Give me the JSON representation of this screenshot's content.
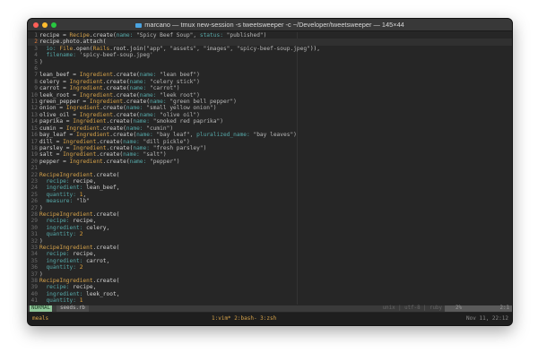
{
  "window": {
    "title": "marcano — tmux new-session -s tweetsweeper -c ~/Developer/tweetsweeper — 145×44",
    "traffic_lights": {
      "close": "#fe5f57",
      "minimize": "#febc2e",
      "maximize": "#28c840"
    }
  },
  "editor": {
    "cursor_line": 2,
    "lines": [
      [
        [
          "recipe = ",
          "t"
        ],
        [
          "Recipe",
          "c"
        ],
        [
          ".create(",
          "t"
        ],
        [
          "name:",
          "k"
        ],
        [
          " \"Spicy Beef Soup\", ",
          "s"
        ],
        [
          "status:",
          "k"
        ],
        [
          " \"published\")",
          "s"
        ]
      ],
      [
        [
          "recipe.photo.attach(",
          "t"
        ]
      ],
      [
        [
          "  ",
          "t"
        ],
        [
          "io:",
          "k"
        ],
        [
          " ",
          "t"
        ],
        [
          "File",
          "c"
        ],
        [
          ".open(",
          "t"
        ],
        [
          "Rails",
          "c"
        ],
        [
          ".root.join(",
          "t"
        ],
        [
          "\"app\", \"assets\", \"images\", \"spicy-beef-soup.jpeg\"",
          "s"
        ],
        [
          ")),",
          "t"
        ]
      ],
      [
        [
          "  ",
          "t"
        ],
        [
          "filename:",
          "k"
        ],
        [
          " 'spicy-beef-soup.jpeg'",
          "s"
        ]
      ],
      [
        [
          ")",
          "t"
        ]
      ],
      [],
      [
        [
          "lean_beef = ",
          "t"
        ],
        [
          "Ingredient",
          "c"
        ],
        [
          ".create(",
          "t"
        ],
        [
          "name:",
          "k"
        ],
        [
          " \"lean beef\")",
          "s"
        ]
      ],
      [
        [
          "celery = ",
          "t"
        ],
        [
          "Ingredient",
          "c"
        ],
        [
          ".create(",
          "t"
        ],
        [
          "name:",
          "k"
        ],
        [
          " \"celery stick\")",
          "s"
        ]
      ],
      [
        [
          "carrot = ",
          "t"
        ],
        [
          "Ingredient",
          "c"
        ],
        [
          ".create(",
          "t"
        ],
        [
          "name:",
          "k"
        ],
        [
          " \"carrot\")",
          "s"
        ]
      ],
      [
        [
          "leek_root = ",
          "t"
        ],
        [
          "Ingredient",
          "c"
        ],
        [
          ".create(",
          "t"
        ],
        [
          "name:",
          "k"
        ],
        [
          " \"leek root\")",
          "s"
        ]
      ],
      [
        [
          "green_pepper = ",
          "t"
        ],
        [
          "Ingredient",
          "c"
        ],
        [
          ".create(",
          "t"
        ],
        [
          "name:",
          "k"
        ],
        [
          " \"green bell pepper\")",
          "s"
        ]
      ],
      [
        [
          "onion = ",
          "t"
        ],
        [
          "Ingredient",
          "c"
        ],
        [
          ".create(",
          "t"
        ],
        [
          "name:",
          "k"
        ],
        [
          " \"small yellow onion\")",
          "s"
        ]
      ],
      [
        [
          "olive_oil = ",
          "t"
        ],
        [
          "Ingredient",
          "c"
        ],
        [
          ".create(",
          "t"
        ],
        [
          "name:",
          "k"
        ],
        [
          " \"olive oil\")",
          "s"
        ]
      ],
      [
        [
          "paprika = ",
          "t"
        ],
        [
          "Ingredient",
          "c"
        ],
        [
          ".create(",
          "t"
        ],
        [
          "name:",
          "k"
        ],
        [
          " \"smoked red paprika\")",
          "s"
        ]
      ],
      [
        [
          "cumin = ",
          "t"
        ],
        [
          "Ingredient",
          "c"
        ],
        [
          ".create(",
          "t"
        ],
        [
          "name:",
          "k"
        ],
        [
          " \"cumin\")",
          "s"
        ]
      ],
      [
        [
          "bay_leaf = ",
          "t"
        ],
        [
          "Ingredient",
          "c"
        ],
        [
          ".create(",
          "t"
        ],
        [
          "name:",
          "k"
        ],
        [
          " \"bay leaf\", ",
          "s"
        ],
        [
          "pluralized_name:",
          "k"
        ],
        [
          " \"bay leaves\")",
          "s"
        ]
      ],
      [
        [
          "dill = ",
          "t"
        ],
        [
          "Ingredient",
          "c"
        ],
        [
          ".create(",
          "t"
        ],
        [
          "name:",
          "k"
        ],
        [
          " \"dill pickle\")",
          "s"
        ]
      ],
      [
        [
          "parsley = ",
          "t"
        ],
        [
          "Ingredient",
          "c"
        ],
        [
          ".create(",
          "t"
        ],
        [
          "name:",
          "k"
        ],
        [
          " \"fresh parsley\")",
          "s"
        ]
      ],
      [
        [
          "salt = ",
          "t"
        ],
        [
          "Ingredient",
          "c"
        ],
        [
          ".create(",
          "t"
        ],
        [
          "name:",
          "k"
        ],
        [
          " \"salt\")",
          "s"
        ]
      ],
      [
        [
          "pepper = ",
          "t"
        ],
        [
          "Ingredient",
          "c"
        ],
        [
          ".create(",
          "t"
        ],
        [
          "name:",
          "k"
        ],
        [
          " \"pepper\")",
          "s"
        ]
      ],
      [],
      [
        [
          "RecipeIngredient",
          "c"
        ],
        [
          ".create(",
          "t"
        ]
      ],
      [
        [
          "  ",
          "t"
        ],
        [
          "recipe:",
          "k"
        ],
        [
          " recipe,",
          "t"
        ]
      ],
      [
        [
          "  ",
          "t"
        ],
        [
          "ingredient:",
          "k"
        ],
        [
          " lean_beef,",
          "t"
        ]
      ],
      [
        [
          "  ",
          "t"
        ],
        [
          "quantity:",
          "k"
        ],
        [
          " ",
          "t"
        ],
        [
          "1",
          "n"
        ],
        [
          ",",
          "t"
        ]
      ],
      [
        [
          "  ",
          "t"
        ],
        [
          "measure:",
          "k"
        ],
        [
          " \"lb\"",
          "s"
        ]
      ],
      [
        [
          ")",
          "t"
        ]
      ],
      [
        [
          "RecipeIngredient",
          "c"
        ],
        [
          ".create(",
          "t"
        ]
      ],
      [
        [
          "  ",
          "t"
        ],
        [
          "recipe:",
          "k"
        ],
        [
          " recipe,",
          "t"
        ]
      ],
      [
        [
          "  ",
          "t"
        ],
        [
          "ingredient:",
          "k"
        ],
        [
          " celery,",
          "t"
        ]
      ],
      [
        [
          "  ",
          "t"
        ],
        [
          "quantity:",
          "k"
        ],
        [
          " ",
          "t"
        ],
        [
          "2",
          "n"
        ]
      ],
      [
        [
          ")",
          "t"
        ]
      ],
      [
        [
          "RecipeIngredient",
          "c"
        ],
        [
          ".create(",
          "t"
        ]
      ],
      [
        [
          "  ",
          "t"
        ],
        [
          "recipe:",
          "k"
        ],
        [
          " recipe,",
          "t"
        ]
      ],
      [
        [
          "  ",
          "t"
        ],
        [
          "ingredient:",
          "k"
        ],
        [
          " carrot,",
          "t"
        ]
      ],
      [
        [
          "  ",
          "t"
        ],
        [
          "quantity:",
          "k"
        ],
        [
          " ",
          "t"
        ],
        [
          "2",
          "n"
        ]
      ],
      [
        [
          ")",
          "t"
        ]
      ],
      [
        [
          "RecipeIngredient",
          "c"
        ],
        [
          ".create(",
          "t"
        ]
      ],
      [
        [
          "  ",
          "t"
        ],
        [
          "recipe:",
          "k"
        ],
        [
          " recipe,",
          "t"
        ]
      ],
      [
        [
          "  ",
          "t"
        ],
        [
          "ingredient:",
          "k"
        ],
        [
          " leek_root,",
          "t"
        ]
      ],
      [
        [
          "  ",
          "t"
        ],
        [
          "quantity:",
          "k"
        ],
        [
          " ",
          "t"
        ],
        [
          "1",
          "n"
        ]
      ]
    ]
  },
  "statusline": {
    "mode": "NORMAL",
    "filename": "seeds.rb",
    "fileinfo": "unix | utf-8 | ruby",
    "percent": "2%",
    "position": "2:1"
  },
  "tmux": {
    "session": "meals",
    "windows": "1:vim* 2:bash- 3:zsh",
    "clock": "Nov 11, 22:12"
  }
}
